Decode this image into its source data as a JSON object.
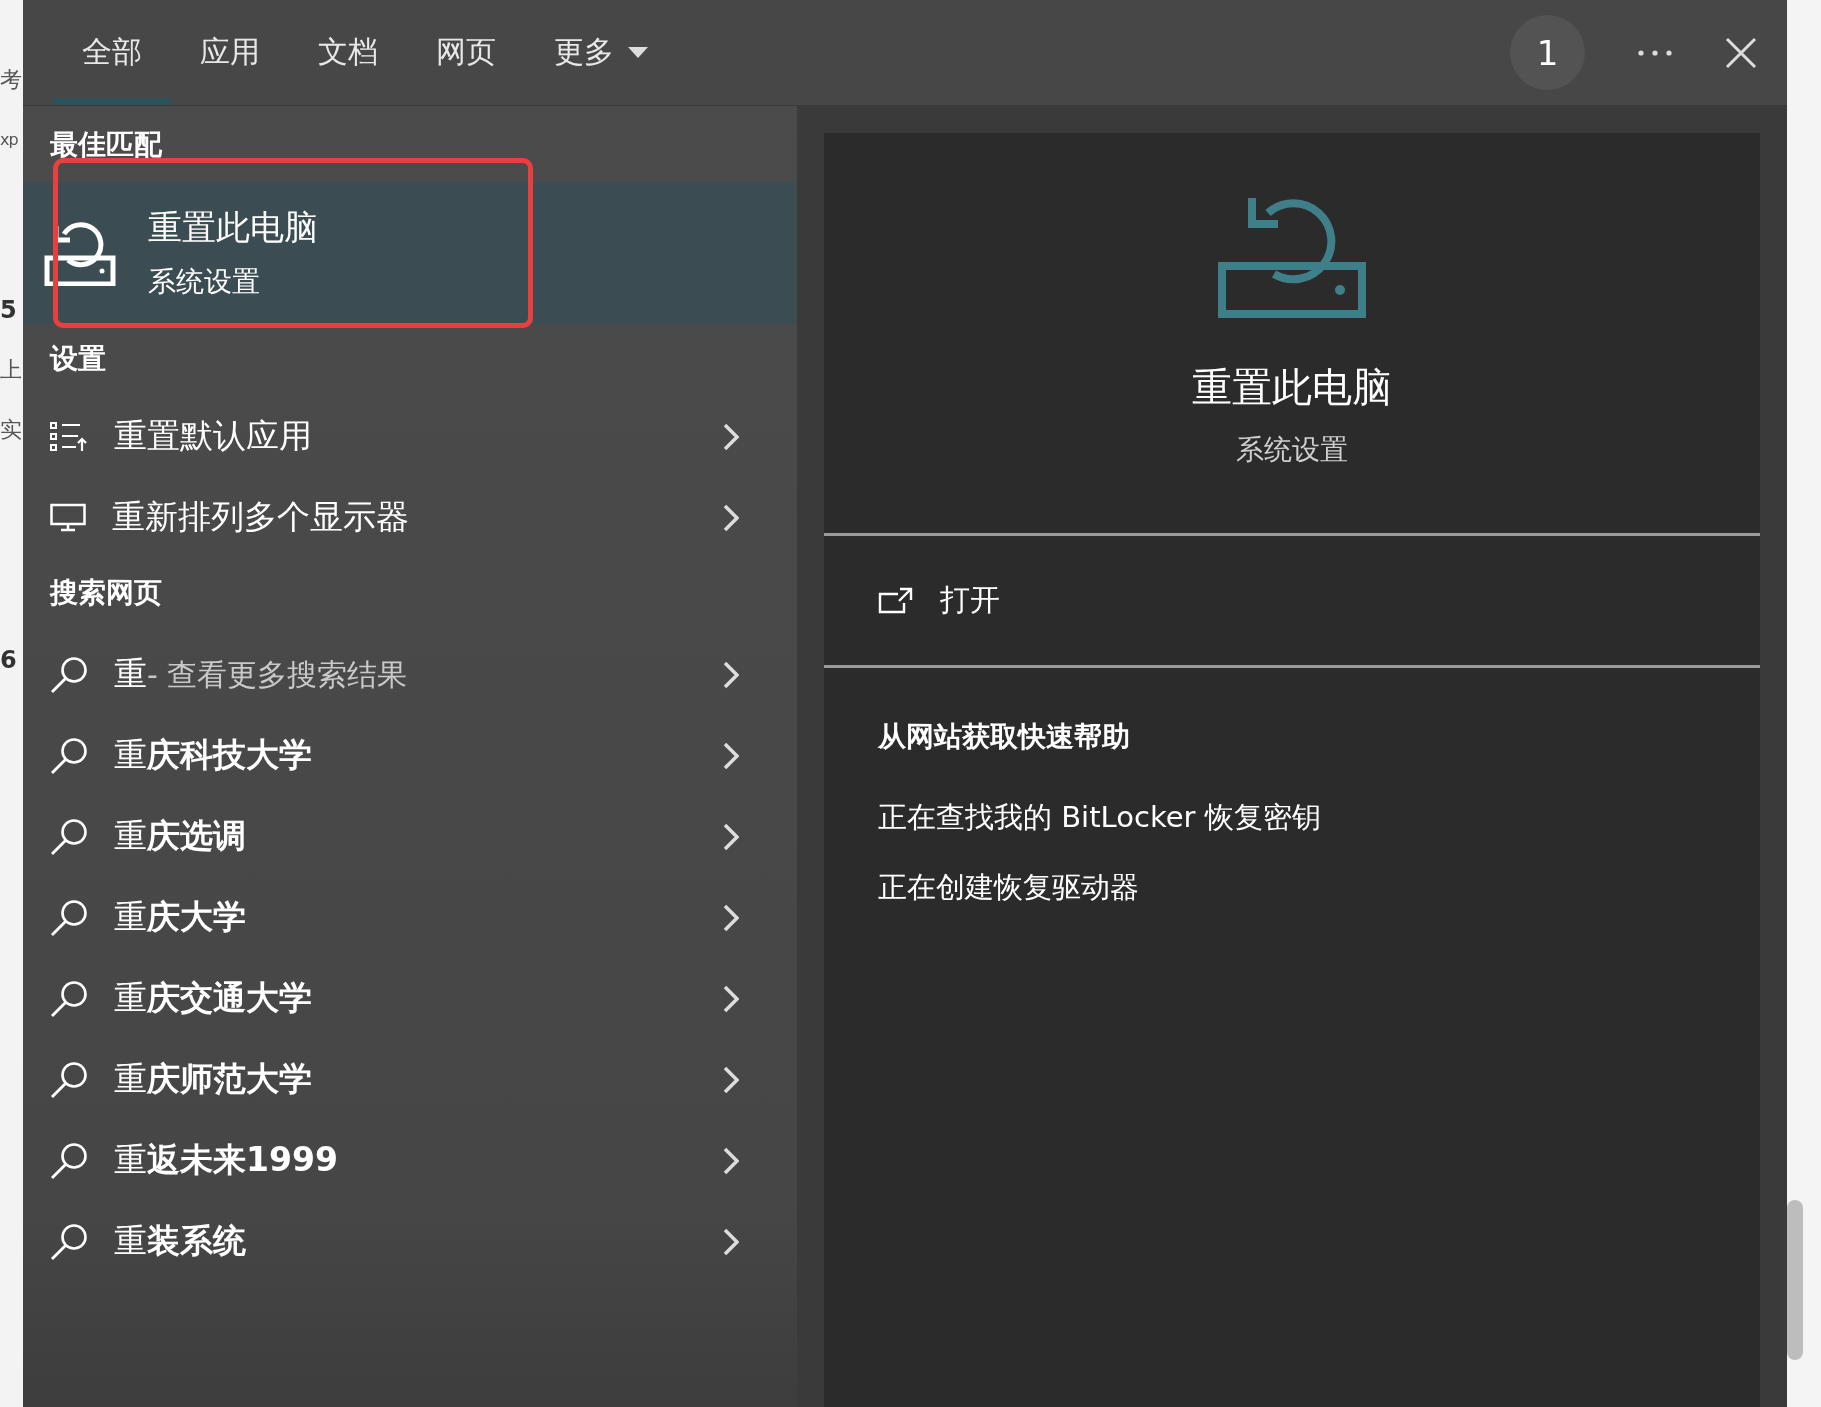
{
  "background_page": {
    "fragments": [
      {
        "text": "考",
        "bold": false
      },
      {
        "text": "xp",
        "bold": false
      },
      {
        "text": "5",
        "bold": true
      },
      {
        "text": "上",
        "bold": false
      },
      {
        "text": "实",
        "bold": false
      },
      {
        "text": "6",
        "bold": true
      }
    ]
  },
  "tabs": [
    {
      "label": "全部",
      "selected": true,
      "kind": "tab"
    },
    {
      "label": "应用",
      "selected": false,
      "kind": "tab"
    },
    {
      "label": "文档",
      "selected": false,
      "kind": "tab"
    },
    {
      "label": "网页",
      "selected": false,
      "kind": "tab"
    },
    {
      "label": "更多",
      "selected": false,
      "kind": "dropdown"
    }
  ],
  "badge": "1",
  "best_match": {
    "heading": "最佳匹配",
    "item": {
      "title": "重置此电脑",
      "subtitle": "系统设置",
      "selected": true,
      "highlighted": true
    }
  },
  "settings": {
    "heading": "设置",
    "items": [
      {
        "label": "重置默认应用",
        "kind": "list"
      },
      {
        "label": "重新排列多个显示器",
        "kind": "monitor"
      }
    ]
  },
  "web": {
    "heading": "搜索网页",
    "items": [
      {
        "label": "重",
        "hint": "- 查看更多搜索结果"
      },
      {
        "label": "重**庆科技大学**"
      },
      {
        "label": "重**庆选调**"
      },
      {
        "label": "重**庆大学**"
      },
      {
        "label": "重**庆交通大学**"
      },
      {
        "label": "重**庆师范大学**"
      },
      {
        "label": "重**返未来1999**"
      },
      {
        "label": "重**装系统**"
      }
    ]
  },
  "detail": {
    "title": "重置此电脑",
    "subtitle": "系统设置",
    "actions": [
      {
        "label": "打开"
      }
    ],
    "help": {
      "heading": "从网站获取快速帮助",
      "links": [
        "正在查找我的 BitLocker 恢复密钥",
        "正在创建恢复驱动器"
      ]
    }
  }
}
